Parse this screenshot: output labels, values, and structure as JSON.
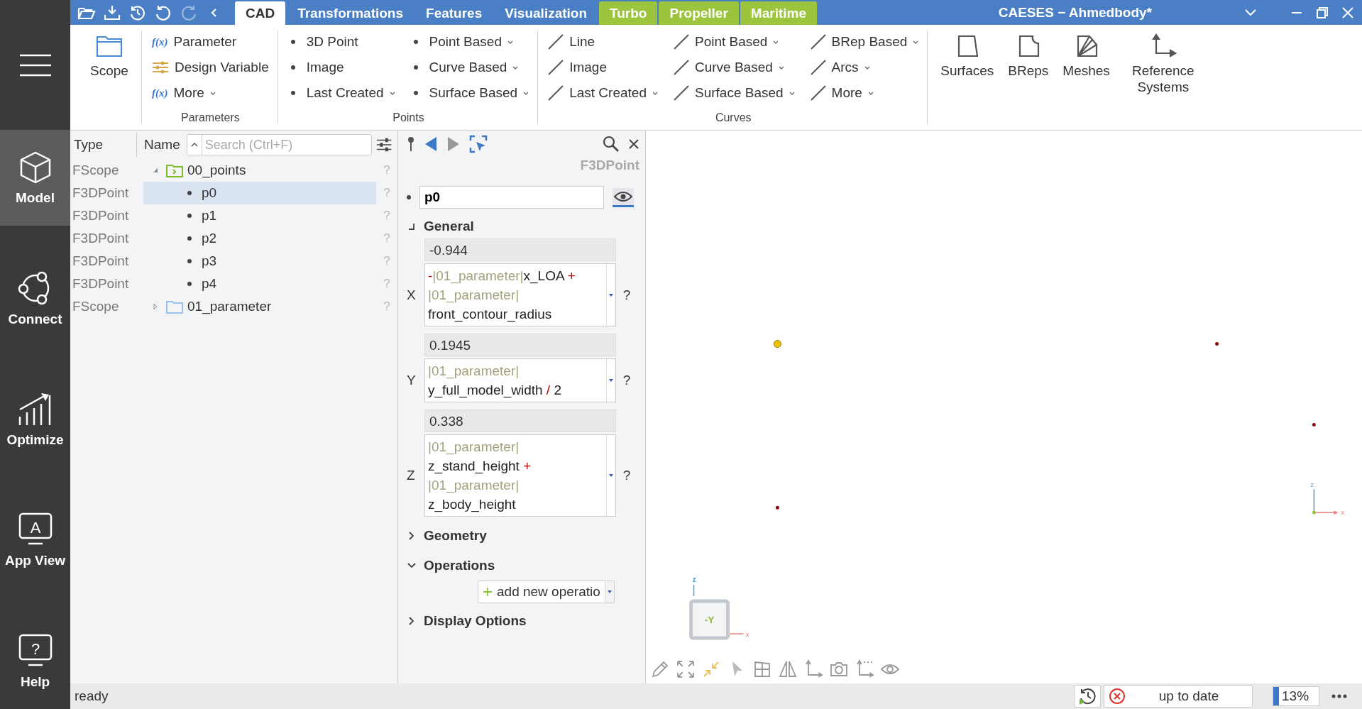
{
  "window": {
    "title": "CAESES − Ahmedbody*"
  },
  "quick_access": [
    {
      "disabled": false
    },
    {
      "disabled": false
    },
    {
      "disabled": false
    },
    {
      "disabled": false
    },
    {
      "disabled": true
    },
    {
      "disabled": false
    }
  ],
  "tabs": [
    {
      "label": "CAD",
      "selected": true,
      "kind": "standard"
    },
    {
      "label": "Transformations",
      "selected": false,
      "kind": "standard"
    },
    {
      "label": "Features",
      "selected": false,
      "kind": "standard"
    },
    {
      "label": "Visualization",
      "selected": false,
      "kind": "standard"
    },
    {
      "label": "Turbo",
      "selected": false,
      "kind": "plugin"
    },
    {
      "label": "Propeller",
      "selected": false,
      "kind": "plugin"
    },
    {
      "label": "Maritime",
      "selected": false,
      "kind": "plugin"
    }
  ],
  "ribbon": {
    "groups": [
      {
        "kind": "big",
        "items": [
          {
            "label": "Scope"
          }
        ]
      },
      {
        "kind": "list",
        "label": "Parameters",
        "columns": [
          [
            {
              "prefix": "f(x)",
              "label": "Parameter",
              "dropdown": false
            },
            {
              "label": "Design Variable",
              "dropdown": false
            },
            {
              "prefix": "f(x)",
              "label": "More",
              "dropdown": true
            }
          ]
        ]
      },
      {
        "kind": "list",
        "label": "Points",
        "columns": [
          [
            {
              "label": "3D Point",
              "dropdown": false
            },
            {
              "label": "Image",
              "dropdown": false
            },
            {
              "label": "Last Created",
              "dropdown": true
            }
          ],
          [
            {
              "label": "Point Based",
              "dropdown": true
            },
            {
              "label": "Curve Based",
              "dropdown": true
            },
            {
              "label": "Surface Based",
              "dropdown": true
            }
          ]
        ]
      },
      {
        "kind": "list",
        "label": "Curves",
        "columns": [
          [
            {
              "label": "Line",
              "dropdown": false
            },
            {
              "label": "Image",
              "dropdown": false
            },
            {
              "label": "Last Created",
              "dropdown": true
            }
          ],
          [
            {
              "label": "Point Based",
              "dropdown": true
            },
            {
              "label": "Curve Based",
              "dropdown": true
            },
            {
              "label": "Surface Based",
              "dropdown": true
            }
          ],
          [
            {
              "label": "BRep Based",
              "dropdown": true
            },
            {
              "label": "Arcs",
              "dropdown": true
            },
            {
              "label": "More",
              "dropdown": true
            }
          ]
        ]
      },
      {
        "kind": "big",
        "items": [
          {
            "label": "Surfaces"
          },
          {
            "label": "BReps"
          },
          {
            "label": "Meshes"
          },
          {
            "label": "Reference Systems"
          }
        ]
      }
    ]
  },
  "sidebar": {
    "items": [
      {
        "label": "Model",
        "selected": true
      },
      {
        "label": "Connect",
        "selected": false
      },
      {
        "label": "Optimize",
        "selected": false
      },
      {
        "label": "App View",
        "glyph": "A",
        "selected": false
      },
      {
        "label": "Help",
        "glyph": "?",
        "selected": false
      }
    ]
  },
  "tree": {
    "columns": [
      "Type",
      "Name"
    ],
    "search": {
      "placeholder": "Search (Ctrl+F)"
    },
    "rows": [
      {
        "type": "FScope",
        "name": "00_points",
        "kind": "folder",
        "expanded": true,
        "selected": false,
        "help": "?",
        "children": [
          {
            "type": "F3DPoint",
            "name": "p0",
            "kind": "point",
            "selected": true,
            "help": "?"
          },
          {
            "type": "F3DPoint",
            "name": "p1",
            "kind": "point",
            "selected": false,
            "help": "?"
          },
          {
            "type": "F3DPoint",
            "name": "p2",
            "kind": "point",
            "selected": false,
            "help": "?"
          },
          {
            "type": "F3DPoint",
            "name": "p3",
            "kind": "point",
            "selected": false,
            "help": "?"
          },
          {
            "type": "F3DPoint",
            "name": "p4",
            "kind": "point",
            "selected": false,
            "help": "?"
          }
        ]
      },
      {
        "type": "FScope",
        "name": "01_parameter",
        "kind": "folder",
        "expanded": false,
        "selected": false,
        "help": "?"
      }
    ]
  },
  "properties": {
    "type": "F3DPoint",
    "name": "p0",
    "visible": true,
    "sections": [
      {
        "title": "General",
        "expanded": true,
        "kind": "coords",
        "coords": [
          {
            "axis": "X",
            "value": "-0.944",
            "help": "?",
            "expression": [
              {
                "kind": "op",
                "text": "-"
              },
              {
                "kind": "ref",
                "text": "|01_parameter|"
              },
              {
                "kind": "name",
                "text": "x_LOA"
              },
              {
                "kind": "op",
                "text": " + "
              },
              {
                "kind": "ref",
                "text": "|01_parameter|"
              },
              {
                "kind": "name",
                "text": "front_contour_radius"
              }
            ]
          },
          {
            "axis": "Y",
            "value": "0.1945",
            "help": "?",
            "expression": [
              {
                "kind": "ref",
                "text": "|01_parameter|"
              },
              {
                "kind": "name",
                "text": "y_full_model_width"
              },
              {
                "kind": "op",
                "text": " / "
              },
              {
                "kind": "name",
                "text": "2"
              }
            ]
          },
          {
            "axis": "Z",
            "value": "0.338",
            "help": "?",
            "expression": [
              {
                "kind": "ref",
                "text": "|01_parameter|"
              },
              {
                "kind": "name",
                "text": "z_stand_height"
              },
              {
                "kind": "op",
                "text": " + "
              },
              {
                "kind": "ref",
                "text": "|01_parameter|"
              },
              {
                "kind": "name",
                "text": "z_body_height"
              }
            ]
          }
        ]
      },
      {
        "title": "Geometry",
        "expanded": false,
        "kind": "plain"
      },
      {
        "title": "Operations",
        "expanded": true,
        "kind": "operations",
        "button": "add new operatio"
      },
      {
        "title": "Display Options",
        "expanded": false,
        "kind": "plain"
      }
    ]
  },
  "viewport": {
    "points": [
      {
        "selected": true
      },
      {
        "selected": false
      },
      {
        "selected": false
      },
      {
        "selected": false
      }
    ],
    "view_cube": {
      "face": "-Y",
      "z": "z",
      "x": "x"
    },
    "triad": {
      "z": "z",
      "x": "x"
    }
  },
  "status_bar": {
    "message": "ready",
    "state": "up to date",
    "error": true,
    "progress": {
      "label": "13%",
      "level": 0.13
    }
  }
}
